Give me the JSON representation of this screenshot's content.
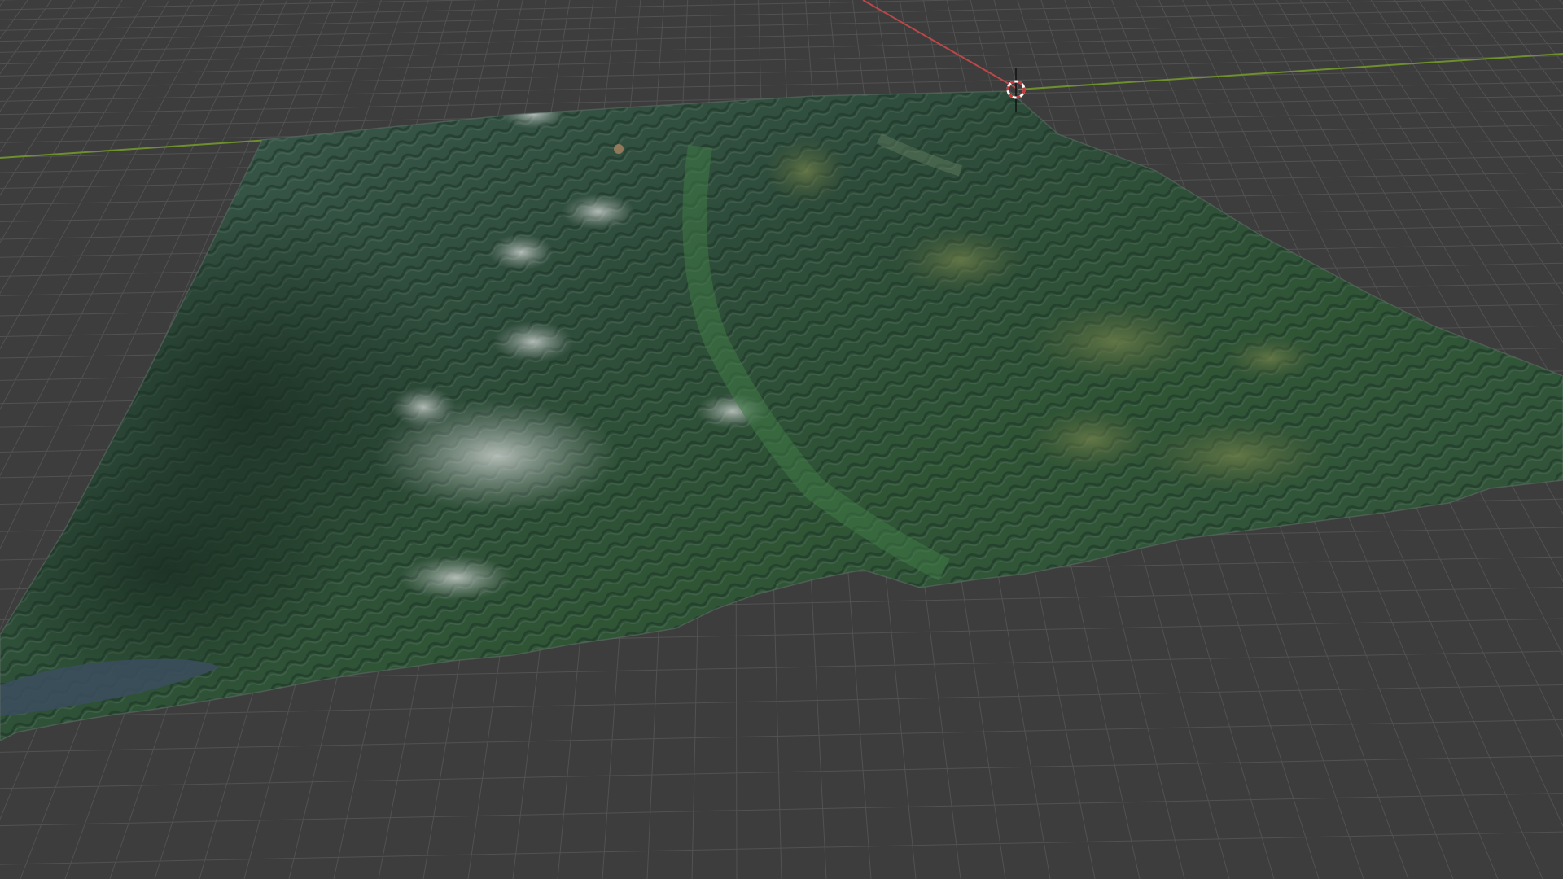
{
  "viewport": {
    "background_color": "#3d3d3d",
    "grid_color": "#525252",
    "x_axis_color": "#b8484a",
    "y_axis_color": "#6e8f2e"
  },
  "terrain": {
    "description_icon": "terrain-mesh",
    "base_color": "#2c4a36",
    "highlight_color": "#9fa9a4",
    "shadow_color": "#1b2e25",
    "lake_color": "#3b4e5c"
  },
  "cursor_3d": {
    "icon": "3d-cursor-icon",
    "ring_color": "#c83a3a",
    "ring_alt_color": "#ffffff"
  }
}
